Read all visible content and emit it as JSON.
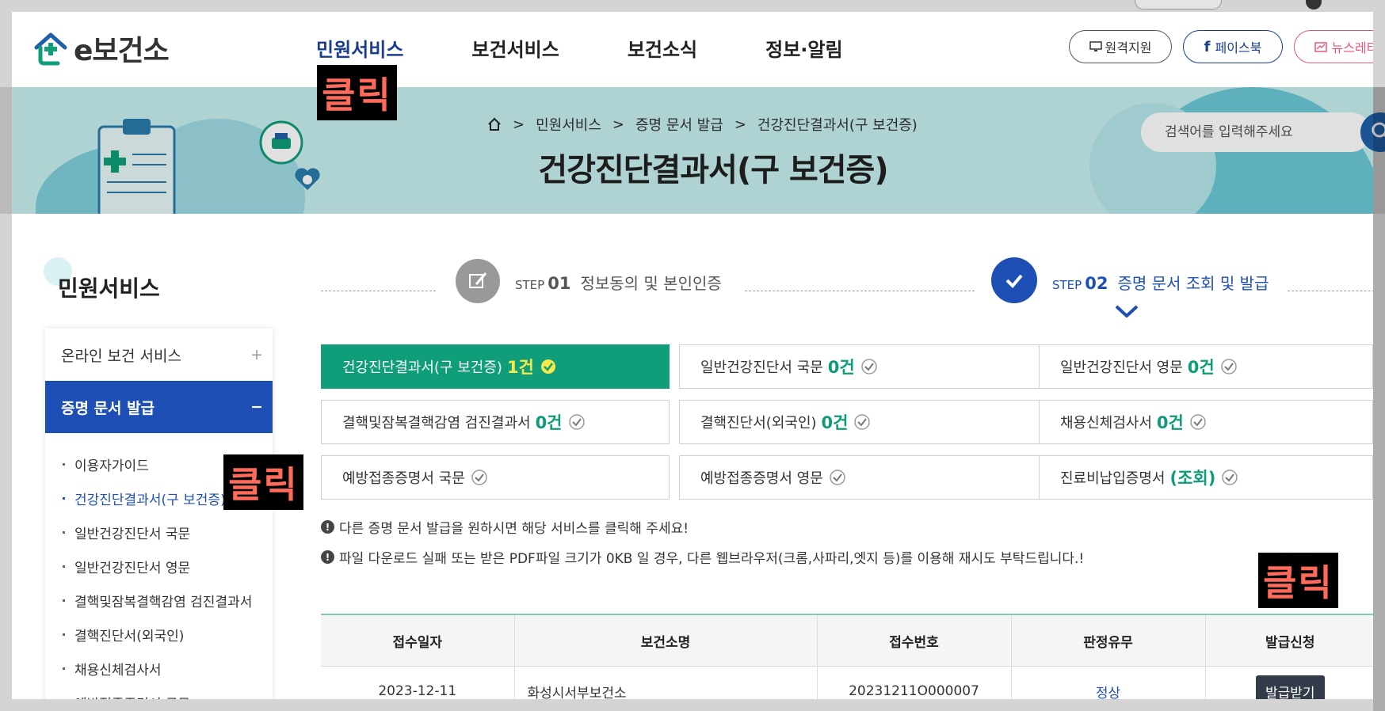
{
  "header": {
    "logo_text": "e보건소",
    "nav": [
      "민원서비스",
      "보건서비스",
      "보건소식",
      "정보·알림"
    ],
    "util_remote": "원격지원",
    "util_facebook": "페이스북",
    "util_newsletter": "뉴스레터"
  },
  "banner": {
    "breadcrumb": [
      "민원서비스",
      "증명 문서 발급",
      "건강진단결과서(구 보건증)"
    ],
    "title": "건강진단결과서(구 보건증)",
    "search_placeholder": "검색어를 입력해주세요"
  },
  "click_tag": "클릭",
  "sidebar": {
    "title": "민원서비스",
    "menu1": "온라인 보건 서비스",
    "menu2": "증명 문서 발급",
    "sub": [
      "이용자가이드",
      "건강진단결과서(구 보건증)",
      "일반건강진단서 국문",
      "일반건강진단서 영문",
      "결핵및잠복결핵감염 검진결과서",
      "결핵진단서(외국인)",
      "채용신체검사서",
      "예방접종증명서 국문"
    ]
  },
  "steps": {
    "step1_prefix": "STEP",
    "step1_num": "01",
    "step1_label": "정보동의 및 본인인증",
    "step2_prefix": "STEP",
    "step2_num": "02",
    "step2_label": "증명 문서 조회 및 발급"
  },
  "documents": [
    {
      "label": "건강진단결과서(구 보건증)",
      "count": "1건"
    },
    {
      "label": "일반건강진단서 국문",
      "count": "0건"
    },
    {
      "label": "일반건강진단서 영문",
      "count": "0건"
    },
    {
      "label": "결핵및잠복결핵감염 검진결과서",
      "count": "0건"
    },
    {
      "label": "결핵진단서(외국인)",
      "count": "0건"
    },
    {
      "label": "채용신체검사서",
      "count": "0건"
    },
    {
      "label": "예방접종증명서 국문",
      "count": ""
    },
    {
      "label": "예방접종증명서 영문",
      "count": ""
    },
    {
      "label": "진료비납입증명서",
      "count": "(조회)"
    }
  ],
  "notices": [
    "다른 증명 문서 발급을 원하시면 해당 서비스를 클릭해 주세요!",
    "파일 다운로드 실패 또는 받은 PDF파일 크기가 0KB 일 경우, 다른 웹브라우저(크롬,사파리,엣지 등)를 이용해 재시도 부탁드립니다.!"
  ],
  "table": {
    "headers": [
      "접수일자",
      "보건소명",
      "접수번호",
      "판정유무",
      "발급신청"
    ],
    "rows": [
      {
        "date": "2023-12-11",
        "center": "화성시서부보건소",
        "number": "20231211O000007",
        "result": "정상",
        "action": "발급받기"
      }
    ]
  },
  "colors": {
    "primary_blue": "#1e4fb5",
    "selected_green": "#0f9e79",
    "banner_bg": "#c8eff0"
  }
}
